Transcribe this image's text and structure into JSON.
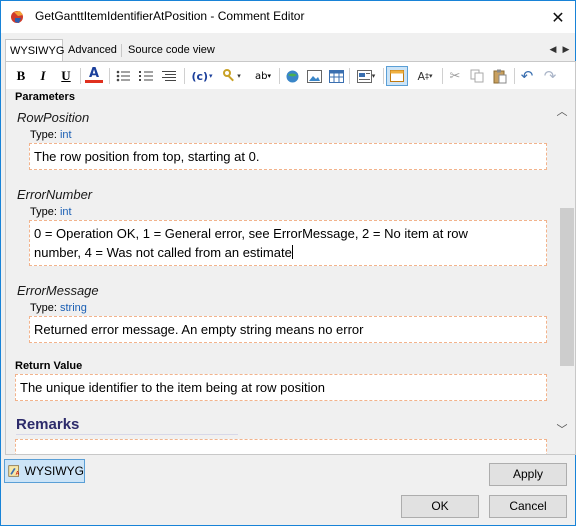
{
  "window": {
    "title": "GetGanttItemIdentifierAtPosition - Comment Editor",
    "close_glyph": "✕"
  },
  "tabs": [
    {
      "label": "WYSIWYG",
      "active": true
    },
    {
      "label": "Advanced",
      "active": false
    },
    {
      "label": "Source code view",
      "active": false
    }
  ],
  "toolbar": {
    "bold": "B",
    "italic": "I",
    "underline": "U",
    "color_a": "A",
    "code": "(c)",
    "subsup": "ab",
    "style": "A"
  },
  "content": {
    "parameters_heading": "Parameters",
    "type_label": "Type:",
    "params": [
      {
        "name": "RowPosition",
        "type": "int",
        "description": "The row position from top, starting at 0."
      },
      {
        "name": "ErrorNumber",
        "type": "int",
        "description_line1": "0 = Operation OK, 1 = General error, see ErrorMessage, 2 = No item at row",
        "description_line2": "number, 4 = Was not called from an estimate"
      },
      {
        "name": "ErrorMessage",
        "type": "string",
        "description": "Returned error message. An empty string means no error"
      }
    ],
    "return_heading": "Return Value",
    "return_text": "The unique identifier to the item being at row position",
    "remarks_heading": "Remarks"
  },
  "bottom": {
    "mode_label": "WYSIWYG",
    "apply": "Apply",
    "ok": "OK",
    "cancel": "Cancel"
  },
  "colors": {
    "accent": "#1883d7",
    "type_link": "#1a5fb4",
    "field_border": "#f2b38c",
    "remarks": "#2d2b6b"
  }
}
